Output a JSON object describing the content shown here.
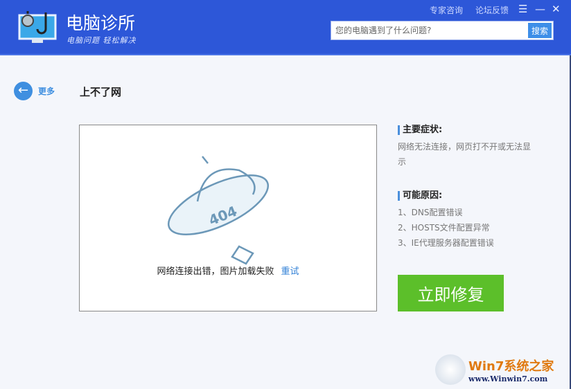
{
  "app": {
    "title": "电脑诊所",
    "slogan": "电脑问题 轻松解决"
  },
  "toplinks": [
    "专家咨询",
    "论坛反馈"
  ],
  "search": {
    "placeholder": "您的电脑遇到了什么问题?",
    "button": "搜索"
  },
  "nav": {
    "back_label": "更多",
    "page_title": "上不了网"
  },
  "panel": {
    "ufo_text": "404",
    "error": "网络连接出错，图片加载失败",
    "retry": "重试"
  },
  "symptoms": {
    "heading": "主要症状:",
    "text": "网络无法连接，网页打不开或无法显示"
  },
  "causes": {
    "heading": "可能原因:",
    "items": [
      "1、DNS配置错误",
      "2、HOSTS文件配置异常",
      "3、IE代理服务器配置错误"
    ]
  },
  "fix_button": "立即修复",
  "watermark": {
    "brand": "Win7系统之家",
    "url": "www.Winwin7.com"
  }
}
